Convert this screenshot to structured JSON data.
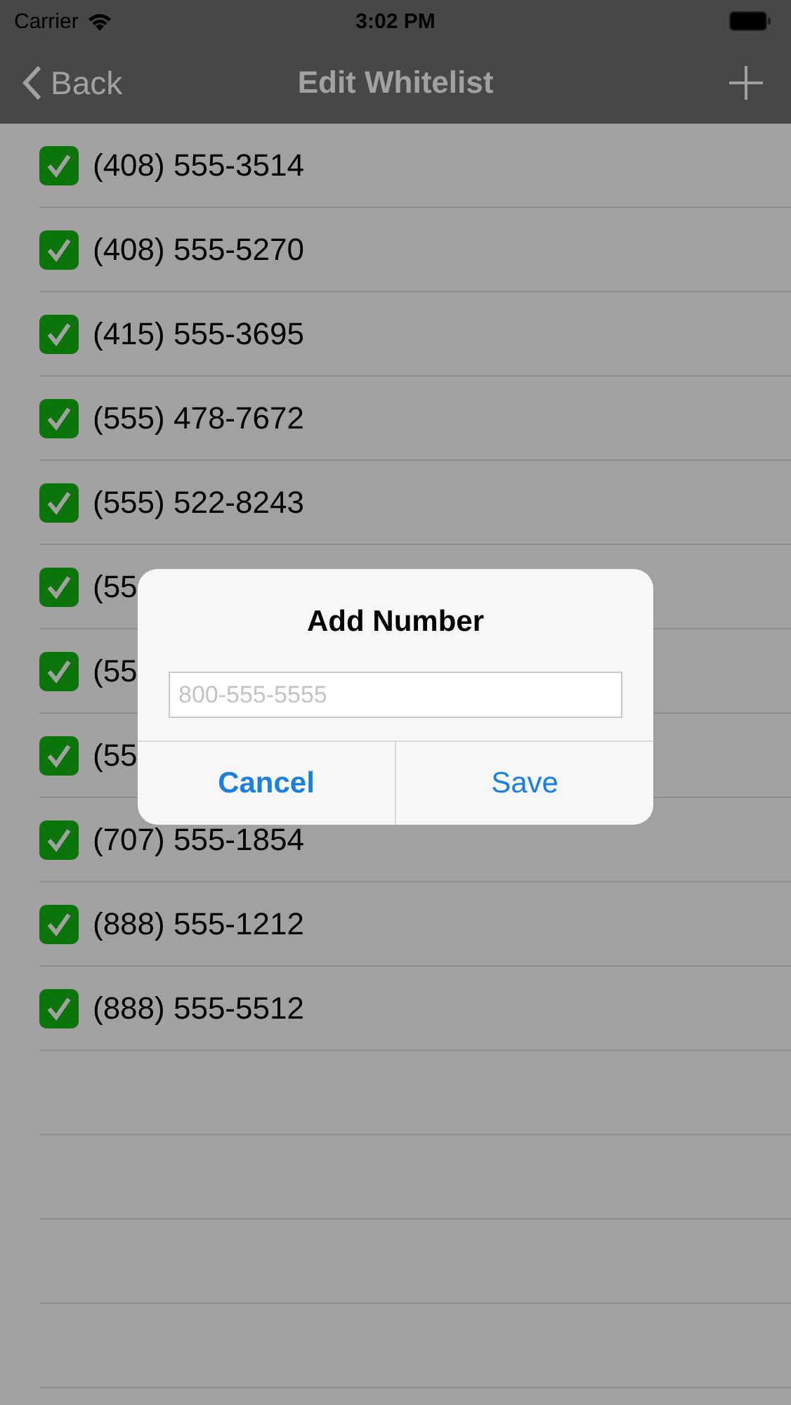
{
  "status_bar": {
    "carrier": "Carrier",
    "time": "3:02 PM"
  },
  "nav_bar": {
    "back": "Back",
    "title": "Edit Whitelist"
  },
  "rows": [
    {
      "number": "(408) 555-3514",
      "checked": true
    },
    {
      "number": "(408) 555-5270",
      "checked": true
    },
    {
      "number": "(415) 555-3695",
      "checked": true
    },
    {
      "number": "(555) 478-7672",
      "checked": true
    },
    {
      "number": "(555) 522-8243",
      "checked": true
    },
    {
      "number": "(55",
      "checked": true
    },
    {
      "number": "(55",
      "checked": true
    },
    {
      "number": "(55",
      "checked": true
    },
    {
      "number": "(707) 555-1854",
      "checked": true
    },
    {
      "number": "(888) 555-1212",
      "checked": true
    },
    {
      "number": "(888) 555-5512",
      "checked": true
    }
  ],
  "alert": {
    "title": "Add Number",
    "field": {
      "placeholder": "800-555-5555"
    },
    "buttons": [
      {
        "label": "Cancel",
        "kind": "cancel"
      },
      {
        "label": "Save",
        "kind": "default"
      }
    ]
  }
}
